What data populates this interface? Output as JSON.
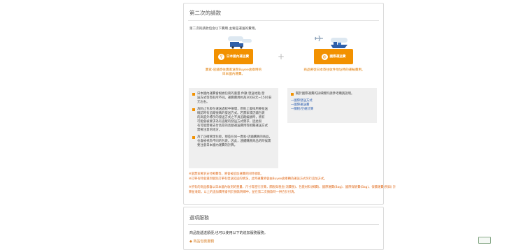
{
  "section1": {
    "title": "第二次的請款",
    "intro": "第二次的請款包含以下費用.主要是運送的費用。",
    "domestic": {
      "label": "日本國內運送費",
      "caption_l1": "賣家-店鋪寄往賣家送至Buyee倉庫時的",
      "caption_l2": "日本國內運費。",
      "icon": "wrench-icon"
    },
    "plus": "+",
    "international": {
      "label": "國際運送費",
      "caption_l1": "商品要從日本寄往收件地址時的運輸費用。",
      "icon": "globe-icon"
    },
    "notes_left": [
      [
        "日本國內運費會根據包裹的重量.件數.發送地點.發",
        "送方式等而有所不同。運費費用約為300日元~1500日",
        "元左右。"
      ],
      [
        "為防止包裹在運送過程中損壞，原則上會採用要投送",
        "確認時有追蹤號碼的發送方式。若賣家或店鋪包裹",
        "的高度外標示的發送方式之不具追蹤編號時，將有",
        "可能會被要求為有追蹤的發送方式需求，因此很",
        "有可能需要支付高昂的高額運送費用等相關運送方式",
        "需要注意的地方。"
      ],
      [
        "為了正確管理包裹，那些在同一賣家-店鋪購買的商品，",
        "也會被視為不同的包裹。因此，連續購買商品的時候需",
        "要注意日本國內運費的計算。"
      ]
    ],
    "notes_right": {
      "heading": "關於國際運費的詳細資料請參考購買說明。",
      "links": [
        "一國際發送方式",
        "一國際運送費",
        "一關稅/空運計算"
      ]
    },
    "warn1": "※當賣家要求支付郵費等，將會被追加運費的同時收取。",
    "warn2": "※訂單有時會遇到個別訂單有發送延誤的情況，此時運費將會由Buyee倉庫轉為運送方式另行追加方式。",
    "warn3_l1": "※所有的商品都會以日本國內收到的重量、尺寸等進行計算，關稅與稅金(消費稅)、包裝材料(郵費)、國際運費(Bag)、國際保險費(Bag)、保價運費(例如) 計",
    "warn3_l2": "算並收取，以上的追加費用會列於請款明細中，並在第二次請款時一併合計付清。"
  },
  "section2": {
    "title": "選項服務",
    "text": "商品能遞送順便,也可以使用以下的追加服務服務。",
    "sub": "◆ 商品包裝服務"
  },
  "colors": {
    "accent": "#f29100",
    "caption": "#e07a00",
    "link": "#2a5db0",
    "warning": "#e06c1e"
  }
}
